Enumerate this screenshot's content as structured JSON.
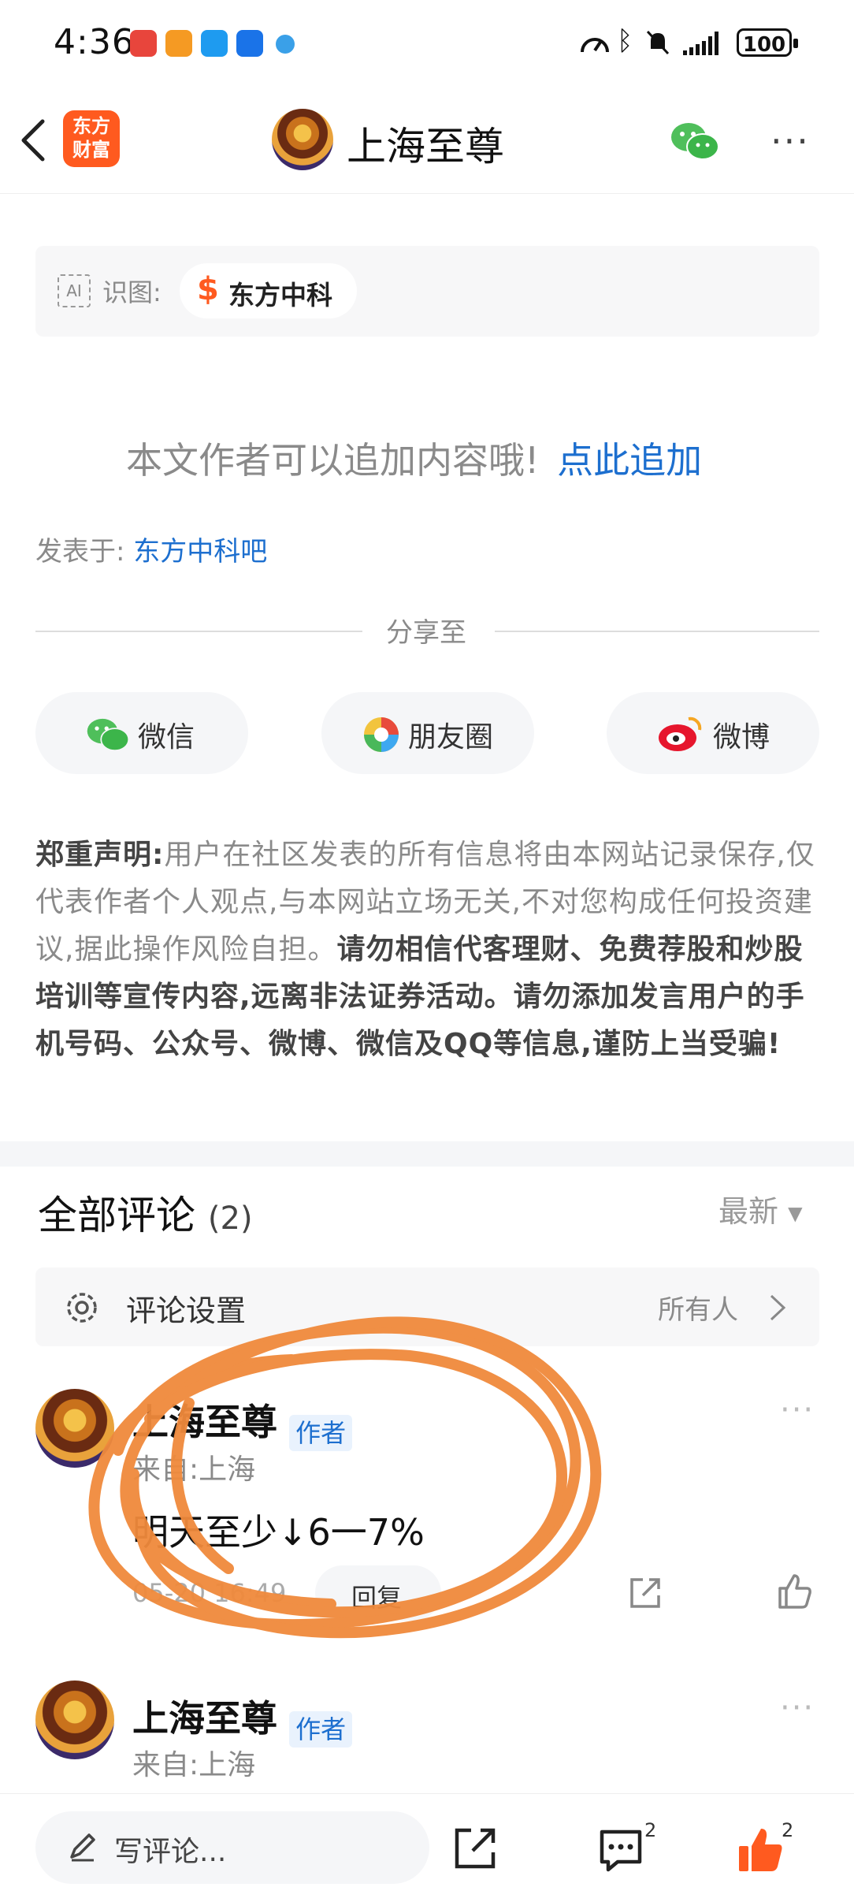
{
  "status_bar": {
    "time": "4:36",
    "battery": "100"
  },
  "header": {
    "brand": "东方\n财富",
    "title": "上海至尊"
  },
  "image_recognition": {
    "label": "识图:",
    "stock": "东方中科"
  },
  "append": {
    "prompt": "本文作者可以追加内容哦!",
    "link": "点此追加"
  },
  "posted_in": {
    "label": "发表于:",
    "forum": "东方中科吧"
  },
  "share": {
    "label": "分享至",
    "buttons": [
      {
        "label": "微信",
        "icon": "wechat-icon"
      },
      {
        "label": "朋友圈",
        "icon": "moments-icon"
      },
      {
        "label": "微博",
        "icon": "weibo-icon"
      }
    ]
  },
  "disclaimer": {
    "title": "郑重声明:",
    "body": "用户在社区发表的所有信息将由本网站记录保存,仅代表作者个人观点,与本网站立场无关,不对您构成任何投资建议,据此操作风险自担。",
    "warning": "请勿相信代客理财、免费荐股和炒股培训等宣传内容,远离非法证券活动。请勿添加发言用户的手机号码、公众号、微博、微信及QQ等信息,谨防上当受骗!"
  },
  "comments_section": {
    "title": "全部评论",
    "count": "(2)",
    "sort": "最新",
    "settings_label": "评论设置",
    "settings_value": "所有人"
  },
  "comments": [
    {
      "author": "上海至尊",
      "tag": "作者",
      "location": "来自:上海",
      "text": "明天至少↓6一7%",
      "time": "05-20 16:49",
      "reply": "回复"
    },
    {
      "author": "上海至尊",
      "tag": "作者",
      "location": "来自:上海"
    }
  ],
  "bottom_bar": {
    "write_placeholder": "写评论...",
    "comment_count": "2",
    "like_count": "2"
  },
  "colors": {
    "accent": "#1d6fcf",
    "brand": "#ff5a1f",
    "annotation": "#f08a3c"
  }
}
